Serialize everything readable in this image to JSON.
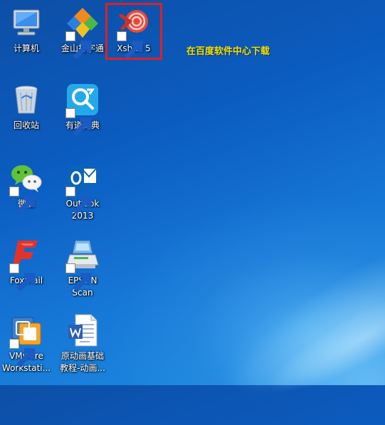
{
  "desktop": {
    "icons": [
      {
        "label": "计算机",
        "icon": "computer-icon"
      },
      {
        "label": "金山打字通",
        "icon": "typing-tutor-icon"
      },
      {
        "label": "Xshell 5",
        "icon": "xshell-icon"
      },
      {
        "label": "回收站",
        "icon": "recycle-bin-icon"
      },
      {
        "label": "有道词典",
        "icon": "youdao-dict-icon"
      },
      {
        "label": "微信",
        "icon": "wechat-icon"
      },
      {
        "label": "Outlook\n2013",
        "icon": "outlook-icon"
      },
      {
        "label": "Foxmail",
        "icon": "foxmail-icon"
      },
      {
        "label": "EPSON\nScan",
        "icon": "epson-scan-icon"
      },
      {
        "label": "VMware\nWorkstati...",
        "icon": "vmware-icon"
      },
      {
        "label": "原动画基础\n教程-动画...",
        "icon": "word-document-icon"
      }
    ],
    "annotation": "在百度软件中心下载",
    "colors": {
      "highlight": "#e02020",
      "annotation": "#f5e000",
      "background": "#0b5cc0"
    }
  }
}
